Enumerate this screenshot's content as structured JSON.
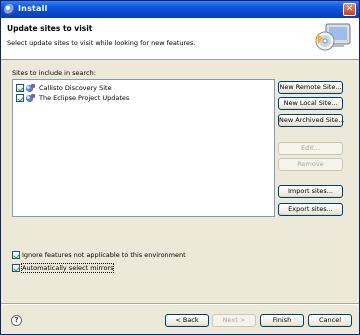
{
  "window": {
    "title": "Install",
    "close_label": "✕"
  },
  "header": {
    "title": "Update sites to visit",
    "description": "Select update sites to visit while looking for new features."
  },
  "sites": {
    "label": "Sites to include in search:",
    "items": [
      {
        "label": "Callisto Discovery Site",
        "checked": true
      },
      {
        "label": "The Eclipse Project Updates",
        "checked": true
      }
    ]
  },
  "side_buttons": {
    "new_remote": "New Remote Site...",
    "new_local": "New Local Site...",
    "new_archived": "New Archived Site...",
    "edit": "Edit...",
    "remove": "Remove",
    "import": "Import sites...",
    "export": "Export sites..."
  },
  "options": {
    "ignore": {
      "label": "Ignore features not applicable to this environment",
      "checked": true
    },
    "mirrors": {
      "label": "Automatically select mirrors",
      "checked": true
    }
  },
  "footer": {
    "help": "?",
    "back": "< Back",
    "next": "Next >",
    "finish": "Finish",
    "cancel": "Cancel"
  }
}
